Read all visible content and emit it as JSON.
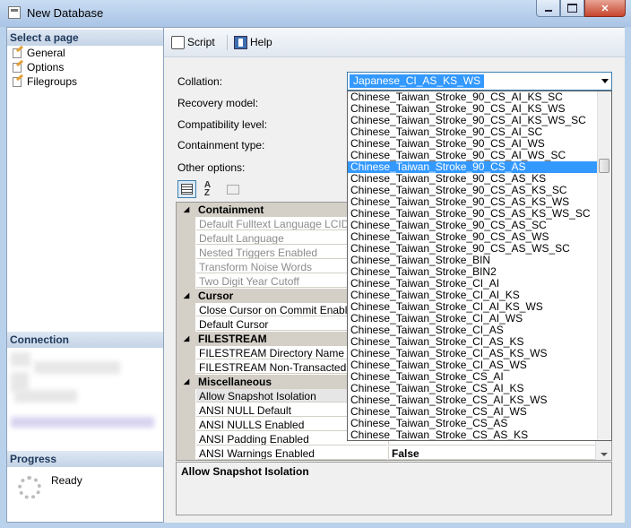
{
  "window": {
    "title": "New Database"
  },
  "left": {
    "select_page_title": "Select a page",
    "pages": [
      "General",
      "Options",
      "Filegroups"
    ],
    "connection_title": "Connection",
    "progress_title": "Progress",
    "progress_status": "Ready"
  },
  "toolbar": {
    "script_label": "Script",
    "help_label": "Help"
  },
  "form": {
    "collation_label": "Collation:",
    "collation_value": "Japanese_CI_AS_KS_WS",
    "recovery_label": "Recovery model:",
    "compat_label": "Compatibility level:",
    "containment_label": "Containment type:",
    "other_label": "Other options:"
  },
  "grid": {
    "containment": {
      "title": "Containment",
      "props": [
        "Default Fulltext Language LCID",
        "Default Language",
        "Nested Triggers Enabled",
        "Transform Noise Words",
        "Two Digit Year Cutoff"
      ]
    },
    "cursor": {
      "title": "Cursor",
      "props": [
        "Close Cursor on Commit Enabled",
        "Default Cursor"
      ]
    },
    "filestream": {
      "title": "FILESTREAM",
      "props": [
        "FILESTREAM Directory Name",
        "FILESTREAM Non-Transacted Access"
      ]
    },
    "misc": {
      "title": "Miscellaneous",
      "props": [
        "Allow Snapshot Isolation",
        "ANSI NULL Default",
        "ANSI NULLS Enabled",
        "ANSI Padding Enabled",
        "ANSI Warnings Enabled"
      ],
      "last_value": "False"
    }
  },
  "description": {
    "title": "Allow Snapshot Isolation"
  },
  "dropdown": {
    "items": [
      "Chinese_Taiwan_Stroke_90_CS_AI_KS_SC",
      "Chinese_Taiwan_Stroke_90_CS_AI_KS_WS",
      "Chinese_Taiwan_Stroke_90_CS_AI_KS_WS_SC",
      "Chinese_Taiwan_Stroke_90_CS_AI_SC",
      "Chinese_Taiwan_Stroke_90_CS_AI_WS",
      "Chinese_Taiwan_Stroke_90_CS_AI_WS_SC",
      "Chinese_Taiwan_Stroke_90_CS_AS",
      "Chinese_Taiwan_Stroke_90_CS_AS_KS",
      "Chinese_Taiwan_Stroke_90_CS_AS_KS_SC",
      "Chinese_Taiwan_Stroke_90_CS_AS_KS_WS",
      "Chinese_Taiwan_Stroke_90_CS_AS_KS_WS_SC",
      "Chinese_Taiwan_Stroke_90_CS_AS_SC",
      "Chinese_Taiwan_Stroke_90_CS_AS_WS",
      "Chinese_Taiwan_Stroke_90_CS_AS_WS_SC",
      "Chinese_Taiwan_Stroke_BIN",
      "Chinese_Taiwan_Stroke_BIN2",
      "Chinese_Taiwan_Stroke_CI_AI",
      "Chinese_Taiwan_Stroke_CI_AI_KS",
      "Chinese_Taiwan_Stroke_CI_AI_KS_WS",
      "Chinese_Taiwan_Stroke_CI_AI_WS",
      "Chinese_Taiwan_Stroke_CI_AS",
      "Chinese_Taiwan_Stroke_CI_AS_KS",
      "Chinese_Taiwan_Stroke_CI_AS_KS_WS",
      "Chinese_Taiwan_Stroke_CI_AS_WS",
      "Chinese_Taiwan_Stroke_CS_AI",
      "Chinese_Taiwan_Stroke_CS_AI_KS",
      "Chinese_Taiwan_Stroke_CS_AI_KS_WS",
      "Chinese_Taiwan_Stroke_CS_AI_WS",
      "Chinese_Taiwan_Stroke_CS_AS",
      "Chinese_Taiwan_Stroke_CS_AS_KS"
    ],
    "highlighted": 6
  }
}
